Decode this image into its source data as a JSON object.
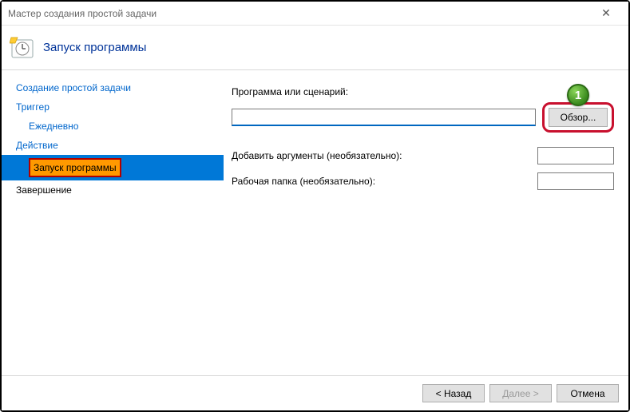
{
  "titlebar": {
    "title": "Мастер создания простой задачи"
  },
  "header": {
    "title": "Запуск программы"
  },
  "sidebar": {
    "items": [
      {
        "label": "Создание простой задачи"
      },
      {
        "label": "Триггер"
      },
      {
        "label": "Ежедневно"
      },
      {
        "label": "Действие"
      },
      {
        "label": "Запуск программы"
      },
      {
        "label": "Завершение"
      }
    ]
  },
  "main": {
    "program_label": "Программа или сценарий:",
    "program_value": "",
    "browse_label": "Обзор...",
    "arguments_label": "Добавить аргументы (необязательно):",
    "arguments_value": "",
    "workdir_label": "Рабочая папка (необязательно):",
    "workdir_value": ""
  },
  "footer": {
    "back": "< Назад",
    "next": "Далее >",
    "cancel": "Отмена"
  },
  "annotation": {
    "badge": "1"
  }
}
